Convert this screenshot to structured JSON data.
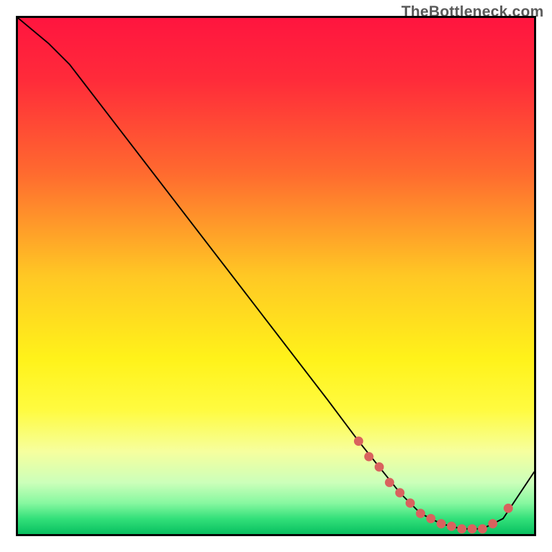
{
  "watermark": "TheBottleneck.com",
  "chart_data": {
    "type": "line",
    "title": "",
    "xlabel": "",
    "ylabel": "",
    "xlim": [
      0,
      100
    ],
    "ylim": [
      0,
      100
    ],
    "curve": {
      "x": [
        0,
        6,
        10,
        20,
        30,
        40,
        50,
        60,
        66,
        70,
        74,
        78,
        82,
        86,
        90,
        94,
        100
      ],
      "y": [
        100,
        95,
        91,
        78,
        65,
        52,
        39,
        26,
        18,
        13,
        8,
        4,
        2,
        1,
        1,
        3,
        12
      ]
    },
    "dots": {
      "x": [
        66,
        68,
        70,
        72,
        74,
        76,
        78,
        80,
        82,
        84,
        86,
        88,
        90,
        92,
        95
      ],
      "y": [
        18,
        15,
        13,
        10,
        8,
        6,
        4,
        3,
        2,
        1.5,
        1,
        1,
        1,
        2,
        5
      ]
    },
    "gradient_stops": [
      {
        "pct": 0,
        "color": "#ff153f"
      },
      {
        "pct": 12,
        "color": "#ff2b3a"
      },
      {
        "pct": 30,
        "color": "#ff6a2f"
      },
      {
        "pct": 50,
        "color": "#ffc824"
      },
      {
        "pct": 66,
        "color": "#fff21a"
      },
      {
        "pct": 76,
        "color": "#fffb40"
      },
      {
        "pct": 84,
        "color": "#f6ff9e"
      },
      {
        "pct": 90,
        "color": "#ccffba"
      },
      {
        "pct": 94,
        "color": "#87f8a0"
      },
      {
        "pct": 97,
        "color": "#33e07a"
      },
      {
        "pct": 100,
        "color": "#08c060"
      }
    ],
    "curve_color": "#000000",
    "dot_color": "#d9625e"
  }
}
